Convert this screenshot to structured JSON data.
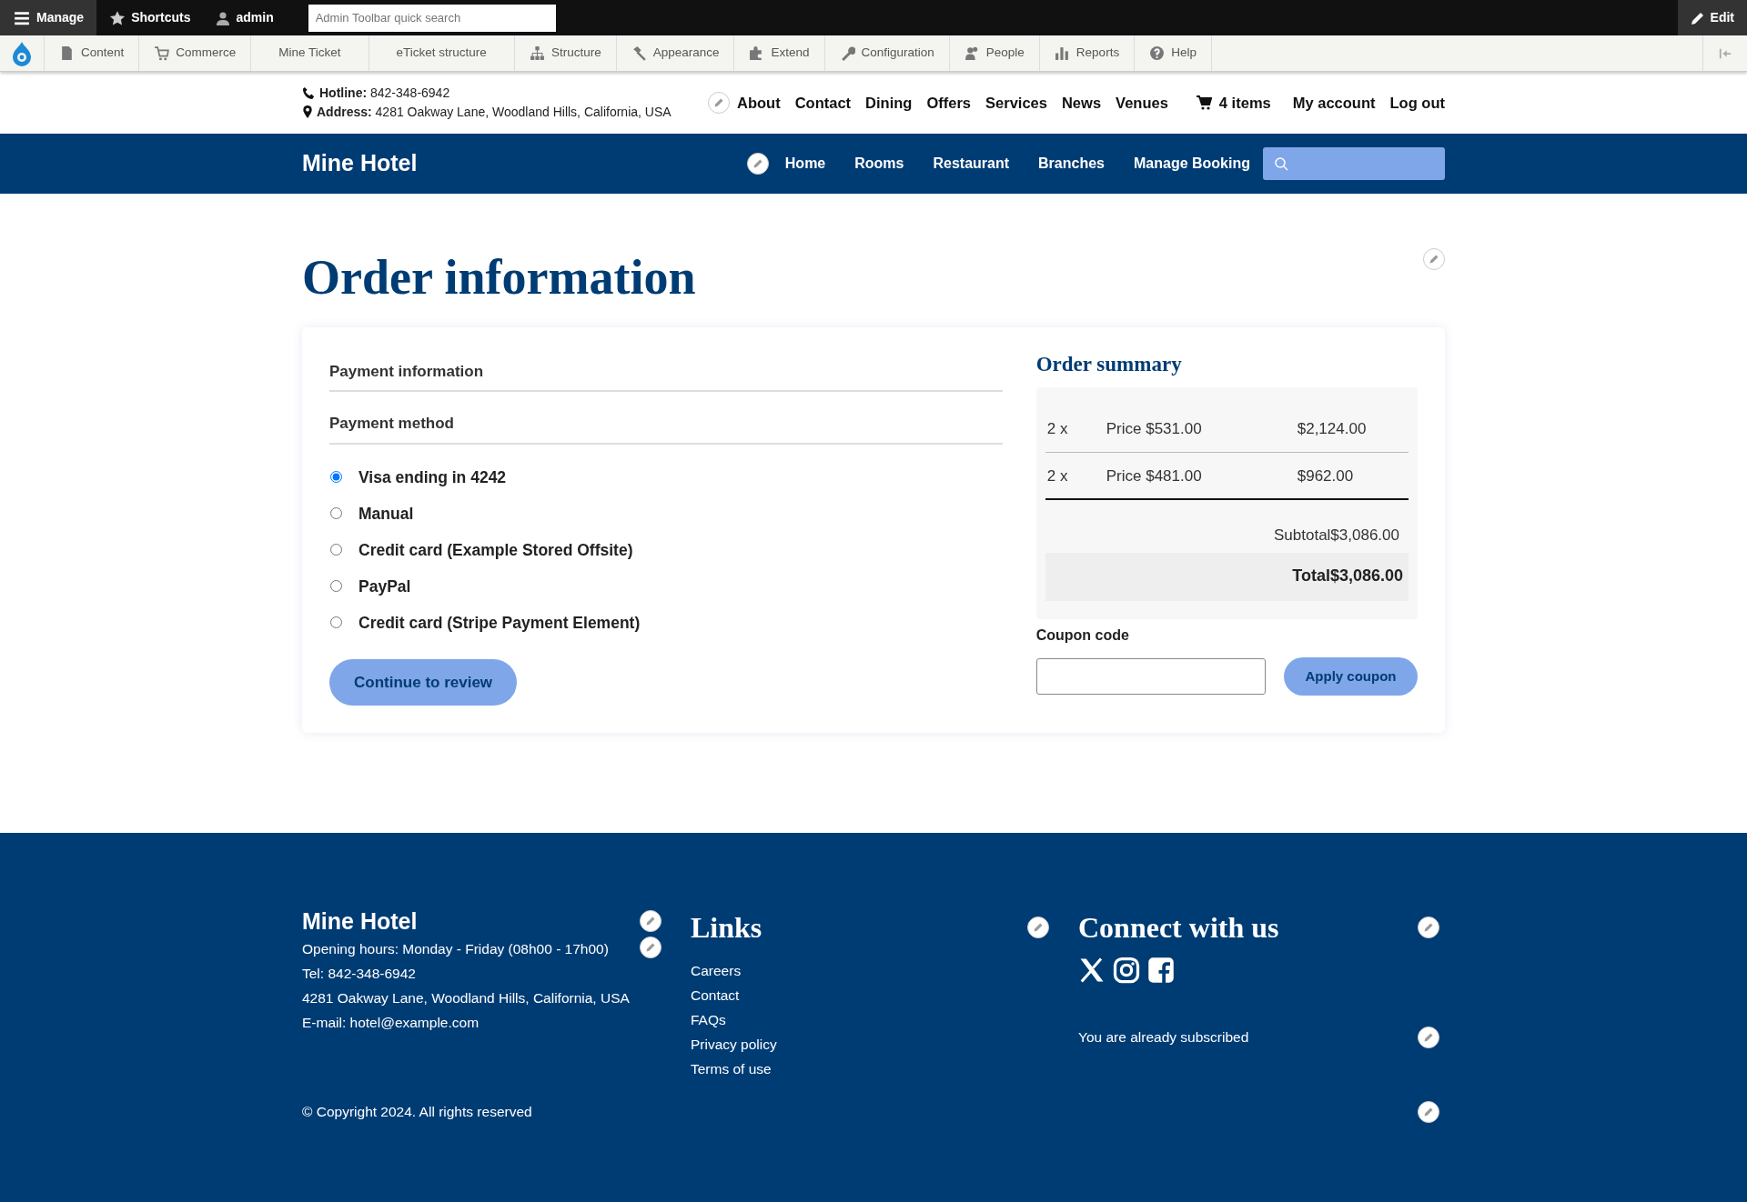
{
  "admin_bar": {
    "items": [
      {
        "label": "Manage",
        "selected": true
      },
      {
        "label": "Shortcuts",
        "selected": false
      },
      {
        "label": "admin",
        "selected": false
      }
    ],
    "search": {
      "placeholder": "Admin Toolbar quick search"
    },
    "edit": "Edit"
  },
  "admin_menu": [
    {
      "label": "Content"
    },
    {
      "label": "Commerce"
    },
    {
      "label": "Mine Ticket"
    },
    {
      "label": "eTicket structure"
    },
    {
      "label": "Structure"
    },
    {
      "label": "Appearance"
    },
    {
      "label": "Extend"
    },
    {
      "label": "Configuration"
    },
    {
      "label": "People"
    },
    {
      "label": "Reports"
    },
    {
      "label": "Help"
    }
  ],
  "contact": {
    "hotline_label": "Hotline:",
    "hotline": "842-348-6942",
    "address_label": "Address:",
    "address": "4281 Oakway Lane, Woodland Hills, California, USA"
  },
  "top_nav": [
    "About",
    "Contact",
    "Dining",
    "Offers",
    "Services",
    "News",
    "Venues"
  ],
  "cart": "4 items",
  "account_links": [
    "My account",
    "Log out"
  ],
  "navbar": {
    "brand": "Mine Hotel",
    "items": [
      "Home",
      "Rooms",
      "Restaurant",
      "Branches",
      "Manage Booking"
    ]
  },
  "page_title": "Order information",
  "payment": {
    "info_heading": "Payment information",
    "method_heading": "Payment method",
    "methods": [
      {
        "label": "Visa ending in 4242",
        "selected": true
      },
      {
        "label": "Manual",
        "selected": false
      },
      {
        "label": "Credit card (Example Stored Offsite)",
        "selected": false
      },
      {
        "label": "PayPal",
        "selected": false
      },
      {
        "label": "Credit card (Stripe Payment Element)",
        "selected": false
      }
    ],
    "continue": "Continue to review"
  },
  "summary": {
    "title": "Order summary",
    "lines": [
      {
        "qty": "2 x",
        "price": "Price $531.00",
        "total": "$2,124.00"
      },
      {
        "qty": "2 x",
        "price": "Price $481.00",
        "total": "$962.00"
      }
    ],
    "subtotal_label": "Subtotal",
    "subtotal": "$3,086.00",
    "total_label": "Total",
    "total": "$3,086.00",
    "coupon_label": "Coupon code",
    "coupon_button": "Apply coupon"
  },
  "footer": {
    "brand": "Mine Hotel",
    "details": [
      "Opening hours: Monday - Friday (08h00 - 17h00)",
      "Tel: 842-348-6942",
      "4281 Oakway Lane, Woodland Hills, California, USA",
      "E-mail: hotel@example.com"
    ],
    "links_title": "Links",
    "links": [
      "Careers",
      "Contact",
      "FAQs",
      "Privacy policy",
      "Terms of use"
    ],
    "connect_title": "Connect with us",
    "subscribed": "You are already subscribed",
    "copyright": "© Copyright 2024. All rights reserved"
  }
}
